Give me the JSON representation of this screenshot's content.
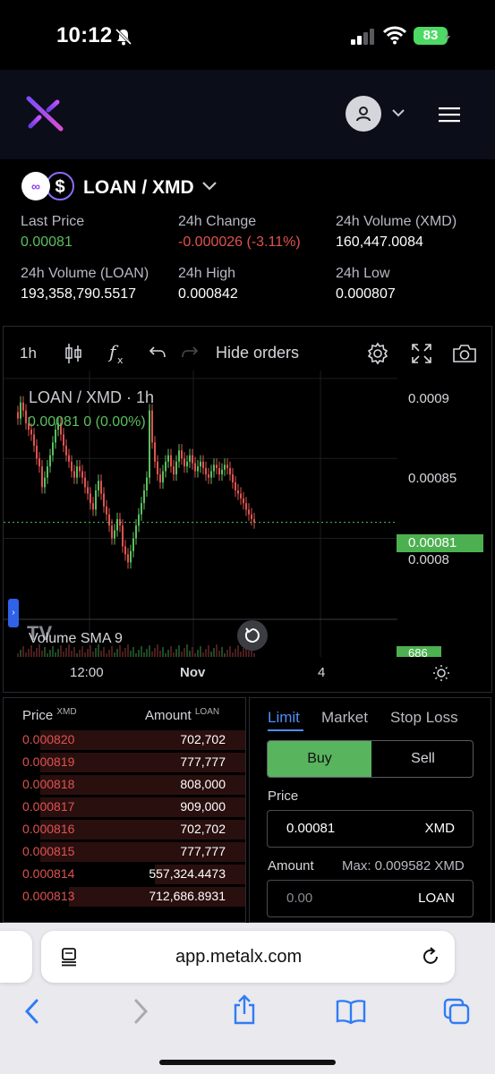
{
  "status_bar": {
    "time": "10:12",
    "battery": "83"
  },
  "header": {
    "logo_icon": "metalx-logo-icon",
    "account_icon": "user-icon",
    "menu_icon": "hamburger-icon"
  },
  "pair": {
    "title": "LOAN / XMD",
    "base_icon": "loan-token-icon",
    "quote_icon": "xmd-dollar-icon"
  },
  "stats": {
    "last_price": {
      "label": "Last Price",
      "value": "0.00081"
    },
    "change_24h": {
      "label": "24h Change",
      "value": "-0.000026 (-3.11%)"
    },
    "volume_xmd": {
      "label": "24h Volume (XMD)",
      "value": "160,447.0084"
    },
    "volume_loan": {
      "label": "24h Volume (LOAN)",
      "value": "193,358,790.5517"
    },
    "high_24h": {
      "label": "24h High",
      "value": "0.000842"
    },
    "low_24h": {
      "label": "24h Low",
      "value": "0.000807"
    }
  },
  "chart_toolbar": {
    "interval": "1h",
    "hide_orders": "Hide orders"
  },
  "chart_data": {
    "type": "candlestick",
    "title": "LOAN / XMD · 1h",
    "legend_value": "0.00081  0 (0.00%)",
    "y_ticks": [
      "0.0009",
      "0.00085",
      "0.0008"
    ],
    "current_price": "0.00081",
    "x_ticks": [
      "12:00",
      "Nov",
      "4"
    ],
    "volume_label": "Volume SMA 9",
    "volume_value": "686",
    "ylim": [
      0.000765,
      0.000905
    ],
    "candles": [
      0.000875,
      0.000885,
      0.00088,
      0.000872,
      0.000868,
      0.000865,
      0.000858,
      0.00085,
      0.000845,
      0.000832,
      0.000838,
      0.000845,
      0.000852,
      0.00086,
      0.000868,
      0.000872,
      0.000865,
      0.000858,
      0.000852,
      0.000848,
      0.000842,
      0.000838,
      0.000845,
      0.000842,
      0.000838,
      0.000832,
      0.000828,
      0.000822,
      0.000818,
      0.00083,
      0.000836,
      0.000828,
      0.00082,
      0.000815,
      0.000808,
      0.0008,
      0.000805,
      0.000812,
      0.000808,
      0.000795,
      0.00079,
      0.000785,
      0.000792,
      0.0008,
      0.000808,
      0.000815,
      0.000822,
      0.00083,
      0.000838,
      0.00088,
      0.00086,
      0.000848,
      0.00084,
      0.000835,
      0.000842,
      0.000848,
      0.000852,
      0.000845,
      0.00084,
      0.000848,
      0.000855,
      0.00085,
      0.000845,
      0.000848,
      0.000852,
      0.000847,
      0.000842,
      0.000845,
      0.000848,
      0.000844,
      0.00084,
      0.000838,
      0.000842,
      0.000846,
      0.000844,
      0.00084,
      0.000843,
      0.000846,
      0.000844,
      0.00084,
      0.000835,
      0.00083,
      0.000828,
      0.000825,
      0.000822,
      0.000818,
      0.000815,
      0.000812,
      0.00081
    ]
  },
  "orderbook": {
    "price_header": "Price",
    "price_unit": "XMD",
    "amount_header": "Amount",
    "amount_unit": "LOAN",
    "rows": [
      {
        "price": "0.000820",
        "amount": "702,702",
        "depth": 0.86
      },
      {
        "price": "0.000819",
        "amount": "777,777",
        "depth": 0.86
      },
      {
        "price": "0.000818",
        "amount": "808,000",
        "depth": 0.86
      },
      {
        "price": "0.000817",
        "amount": "909,000",
        "depth": 0.86
      },
      {
        "price": "0.000816",
        "amount": "702,702",
        "depth": 0.86
      },
      {
        "price": "0.000815",
        "amount": "777,777",
        "depth": 0.86
      },
      {
        "price": "0.000814",
        "amount": "557,324.4473",
        "depth": 0.38
      },
      {
        "price": "0.000813",
        "amount": "712,686.8931",
        "depth": 0.74
      }
    ]
  },
  "trade": {
    "tabs": [
      "Limit",
      "Market",
      "Stop Loss"
    ],
    "buy": "Buy",
    "sell": "Sell",
    "price_label": "Price",
    "price_value": "0.00081",
    "price_unit": "XMD",
    "amount_label": "Amount",
    "amount_max": "Max: 0.009582 XMD",
    "amount_placeholder": "0.00",
    "amount_unit": "LOAN"
  },
  "browser": {
    "url": "app.metalx.com"
  },
  "colors": {
    "up": "#5bbf5e",
    "down": "#e0534f",
    "accent": "#4e8ef7"
  }
}
